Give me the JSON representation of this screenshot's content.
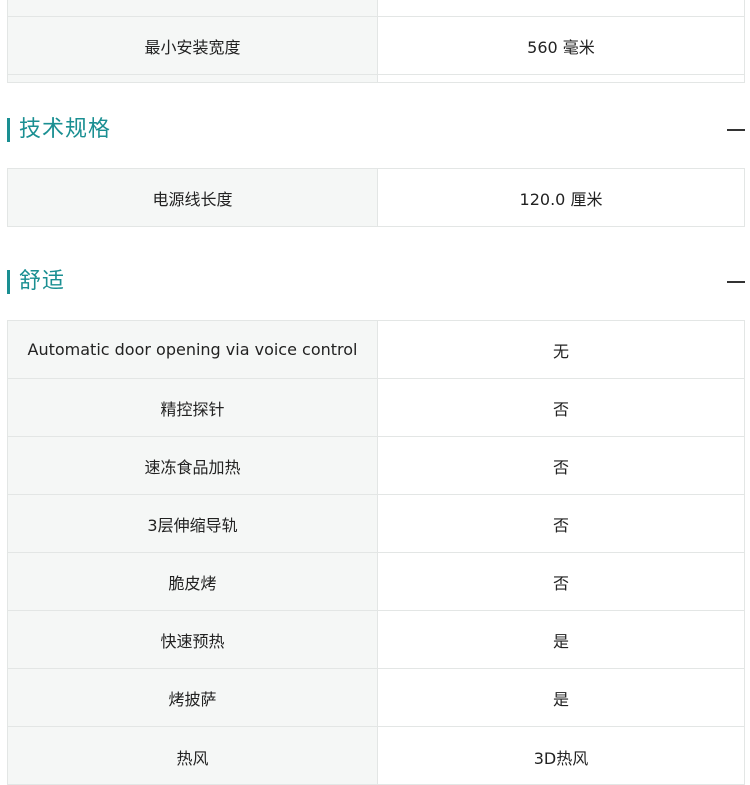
{
  "top_table": {
    "rows": [
      {
        "key": "",
        "value": ""
      },
      {
        "key": "最小安装宽度",
        "value": "560 毫米"
      },
      {
        "key": "",
        "value": ""
      }
    ]
  },
  "sections": [
    {
      "title": "技术规格",
      "rows": [
        {
          "key": "电源线长度",
          "value": "120.0 厘米"
        }
      ]
    },
    {
      "title": "舒适",
      "rows": [
        {
          "key": "Automatic door opening via voice control",
          "value": "无"
        },
        {
          "key": "精控探针",
          "value": "否"
        },
        {
          "key": "速冻食品加热",
          "value": "否"
        },
        {
          "key": "3层伸缩导轨",
          "value": "否"
        },
        {
          "key": "脆皮烤",
          "value": "否"
        },
        {
          "key": "快速预热",
          "value": "是"
        },
        {
          "key": "烤披萨",
          "value": "是"
        },
        {
          "key": "热风",
          "value": "3D热风"
        }
      ]
    }
  ]
}
